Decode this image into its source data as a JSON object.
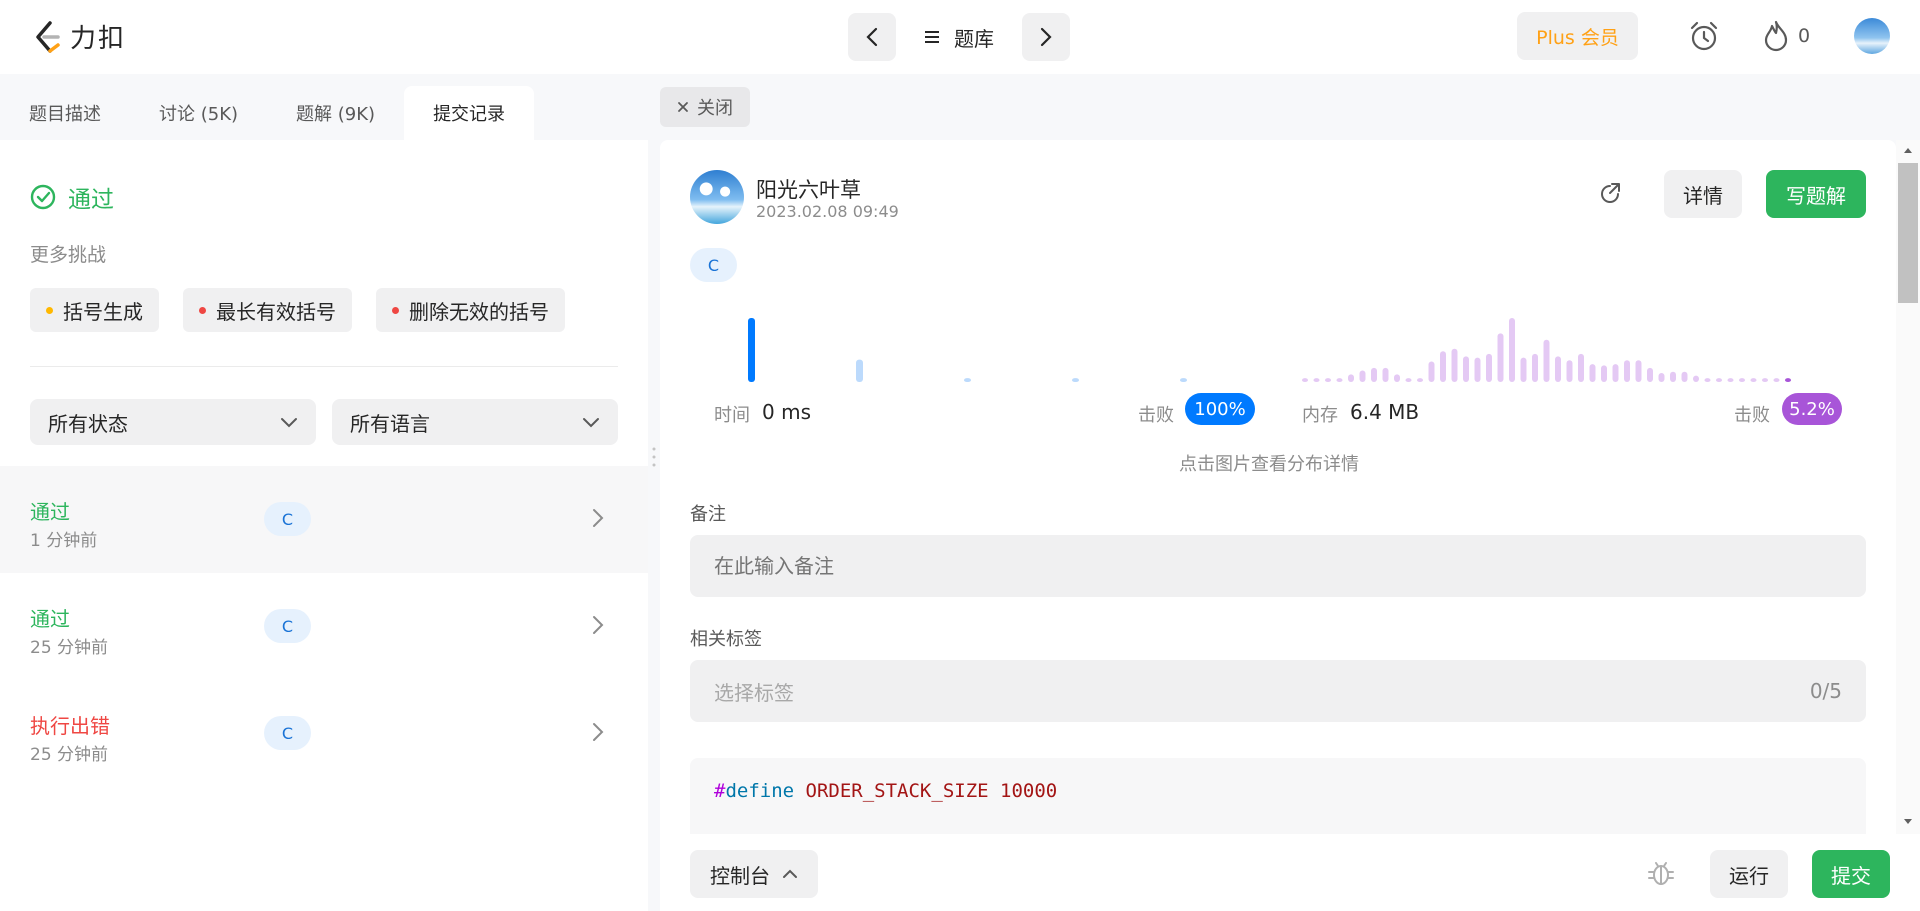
{
  "topnav": {
    "logo_text": "力扣",
    "problem_list_label": "题库",
    "plus_label": "Plus 会员",
    "streak_count": "0"
  },
  "left_tabs": [
    {
      "label": "题目描述"
    },
    {
      "label": "讨论 (5K)"
    },
    {
      "label": "题解 (9K)"
    },
    {
      "label": "提交记录"
    }
  ],
  "result": {
    "status": "通过",
    "more_challenges_title": "更多挑战",
    "challenges": [
      {
        "label": "括号生成",
        "dot_color": "#ffb800"
      },
      {
        "label": "最长有效括号",
        "dot_color": "#ef4743"
      },
      {
        "label": "删除无效的括号",
        "dot_color": "#ef4743"
      }
    ]
  },
  "filters": {
    "status_select": "所有状态",
    "language_select": "所有语言"
  },
  "submissions": [
    {
      "status": "通过",
      "status_color": "#2db55d",
      "time": "1 分钟前",
      "lang": "C"
    },
    {
      "status": "通过",
      "status_color": "#2db55d",
      "time": "25 分钟前",
      "lang": "C"
    },
    {
      "status": "执行出错",
      "status_color": "#ef4743",
      "time": "25 分钟前",
      "lang": "C"
    }
  ],
  "detail": {
    "close_label": "关闭",
    "user_name": "阳光六叶草",
    "date": "2023.02.08 09:49",
    "detail_button": "详情",
    "write_solution_button": "写题解",
    "language": "C",
    "runtime_label": "时间",
    "runtime_value": "0 ms",
    "runtime_beat_label": "击败",
    "runtime_beat": "100%",
    "memory_label": "内存",
    "memory_value": "6.4 MB",
    "memory_beat_label": "击败",
    "memory_beat": "5.2%",
    "chart_hint": "点击图片查看分布详情",
    "note_label": "备注",
    "note_placeholder": "在此输入备注",
    "tags_label": "相关标签",
    "tags_placeholder": "选择标签",
    "tags_count": "0/5",
    "code_hash": "#",
    "code_define": "define",
    "code_rest": "ORDER_STACK_SIZE 10000"
  },
  "bottom": {
    "console_label": "控制台",
    "run_label": "运行",
    "submit_label": "提交"
  },
  "colors": {
    "accent_green": "#2db55d",
    "runtime_blue": "#007aff",
    "memory_purple": "#a855d8",
    "plus_orange": "#ffa116"
  },
  "distribution": {
    "runtime_bars": [
      1.0,
      0.35,
      0.06,
      0.06,
      0.06
    ],
    "memory_bars": [
      0.06,
      0.06,
      0.06,
      0.06,
      0.12,
      0.18,
      0.22,
      0.22,
      0.12,
      0.06,
      0.06,
      0.32,
      0.48,
      0.52,
      0.4,
      0.38,
      0.44,
      0.76,
      1.0,
      0.38,
      0.44,
      0.66,
      0.4,
      0.34,
      0.44,
      0.28,
      0.26,
      0.28,
      0.34,
      0.34,
      0.22,
      0.14,
      0.16,
      0.16,
      0.1,
      0.06,
      0.06,
      0.06,
      0.06,
      0.06,
      0.06,
      0.06,
      0.06
    ]
  }
}
